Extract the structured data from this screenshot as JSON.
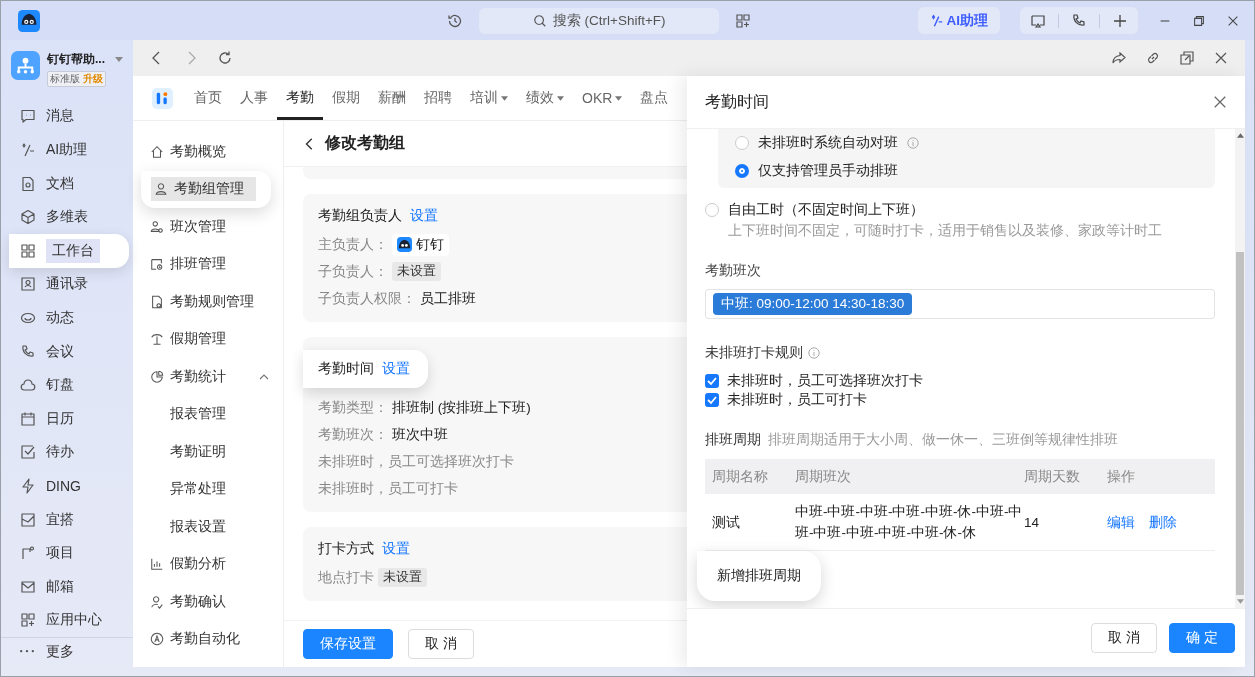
{
  "titlebar": {
    "search_placeholder": "搜索 (Ctrl+Shift+F)",
    "ai_button": "AI助理"
  },
  "org": {
    "name": "钉钉帮助...",
    "edition": "标准版",
    "upgrade": "升级"
  },
  "sidebar": {
    "items": [
      {
        "label": "消息",
        "selected": false
      },
      {
        "label": "AI助理",
        "selected": false
      },
      {
        "label": "文档",
        "selected": false
      },
      {
        "label": "多维表",
        "selected": false
      },
      {
        "label": "工作台",
        "selected": true
      },
      {
        "label": "通讯录",
        "selected": false
      },
      {
        "label": "动态",
        "selected": false
      },
      {
        "label": "会议",
        "selected": false
      },
      {
        "label": "钉盘",
        "selected": false
      },
      {
        "label": "日历",
        "selected": false
      },
      {
        "label": "待办",
        "selected": false
      },
      {
        "label": "DING",
        "selected": false
      },
      {
        "label": "宜搭",
        "selected": false
      },
      {
        "label": "项目",
        "selected": false
      },
      {
        "label": "邮箱",
        "selected": false
      },
      {
        "label": "应用中心",
        "selected": false
      }
    ],
    "more": "更多"
  },
  "tabs": [
    {
      "label": "首页",
      "selected": false,
      "dropdown": false
    },
    {
      "label": "人事",
      "selected": false,
      "dropdown": false
    },
    {
      "label": "考勤",
      "selected": true,
      "dropdown": false
    },
    {
      "label": "假期",
      "selected": false,
      "dropdown": false
    },
    {
      "label": "薪酬",
      "selected": false,
      "dropdown": false
    },
    {
      "label": "招聘",
      "selected": false,
      "dropdown": false
    },
    {
      "label": "培训",
      "selected": false,
      "dropdown": true
    },
    {
      "label": "绩效",
      "selected": false,
      "dropdown": true
    },
    {
      "label": "OKR",
      "selected": false,
      "dropdown": true
    },
    {
      "label": "盘点",
      "selected": false,
      "dropdown": false
    }
  ],
  "subnav": [
    {
      "label": "考勤概览",
      "selected": false
    },
    {
      "label": "考勤组管理",
      "selected": true
    },
    {
      "label": "班次管理",
      "selected": false
    },
    {
      "label": "排班管理",
      "selected": false
    },
    {
      "label": "考勤规则管理",
      "selected": false
    },
    {
      "label": "假期管理",
      "selected": false
    },
    {
      "label": "考勤统计",
      "selected": false,
      "expanded": true,
      "children": [
        {
          "label": "报表管理",
          "selected": false
        },
        {
          "label": "考勤证明",
          "selected": false
        },
        {
          "label": "异常处理",
          "selected": false
        },
        {
          "label": "报表设置",
          "selected": false
        }
      ]
    },
    {
      "label": "假勤分析",
      "selected": false
    },
    {
      "label": "考勤确认",
      "selected": false
    },
    {
      "label": "考勤自动化",
      "selected": false
    }
  ],
  "page": {
    "title": "修改考勤组",
    "cards": [
      {
        "title": "考勤组负责人",
        "link": "设置",
        "highlighted": false,
        "rows": [
          {
            "kind": "person",
            "label": "主负责人：",
            "value": "钉钉"
          },
          {
            "kind": "tag",
            "label": "子负责人：",
            "value": "未设置"
          },
          {
            "kind": "text",
            "label": "子负责人权限：",
            "value": "员工排班"
          }
        ]
      },
      {
        "title": "考勤时间",
        "link": "设置",
        "highlighted": true,
        "rows": [
          {
            "kind": "text",
            "label": "考勤类型：",
            "value": "排班制 (按排班上下班)"
          },
          {
            "kind": "text",
            "label": "考勤班次：",
            "value": "班次中班"
          },
          {
            "kind": "note",
            "value": "未排班时，员工可选择班次打卡"
          },
          {
            "kind": "note",
            "value": "未排班时，员工可打卡"
          }
        ]
      },
      {
        "title": "打卡方式",
        "link": "设置",
        "highlighted": false,
        "rows": [
          {
            "kind": "tag",
            "label": "地点打卡",
            "value": "未设置"
          }
        ]
      }
    ],
    "save": "保存设置",
    "cancel": "取 消"
  },
  "drawer": {
    "title": "考勤时间",
    "schedule_options": [
      {
        "label": "未排班时系统自动对班",
        "info": true,
        "selected": false
      },
      {
        "label": "仅支持管理员手动排班",
        "info": false,
        "selected": true
      }
    ],
    "free_hours": {
      "label": "自由工时（不固定时间上下班）",
      "description": "上下班时间不固定，可随时打卡，适用于销售以及装修、家政等计时工",
      "selected": false
    },
    "shift_label": "考勤班次",
    "shift_tag": "中班: 09:00-12:00 14:30-18:30",
    "rules_title": "未排班打卡规则",
    "rules": [
      {
        "label": "未排班时，员工可选择班次打卡",
        "checked": true
      },
      {
        "label": "未排班时，员工可打卡",
        "checked": true
      }
    ],
    "cycle_title": "排班周期",
    "cycle_hint": "排班周期适用于大小周、做一休一、三班倒等规律性排班",
    "table": {
      "columns": [
        "周期名称",
        "周期班次",
        "周期天数",
        "操作"
      ],
      "rows": [
        {
          "name": "测试",
          "shifts": "中班-中班-中班-中班-中班-休-中班-中班-中班-中班-中班-中班-休-休",
          "days": "14",
          "actions": [
            "编辑",
            "删除"
          ]
        }
      ]
    },
    "add_button": "新增排班周期",
    "cancel": "取 消",
    "confirm": "确 定"
  }
}
